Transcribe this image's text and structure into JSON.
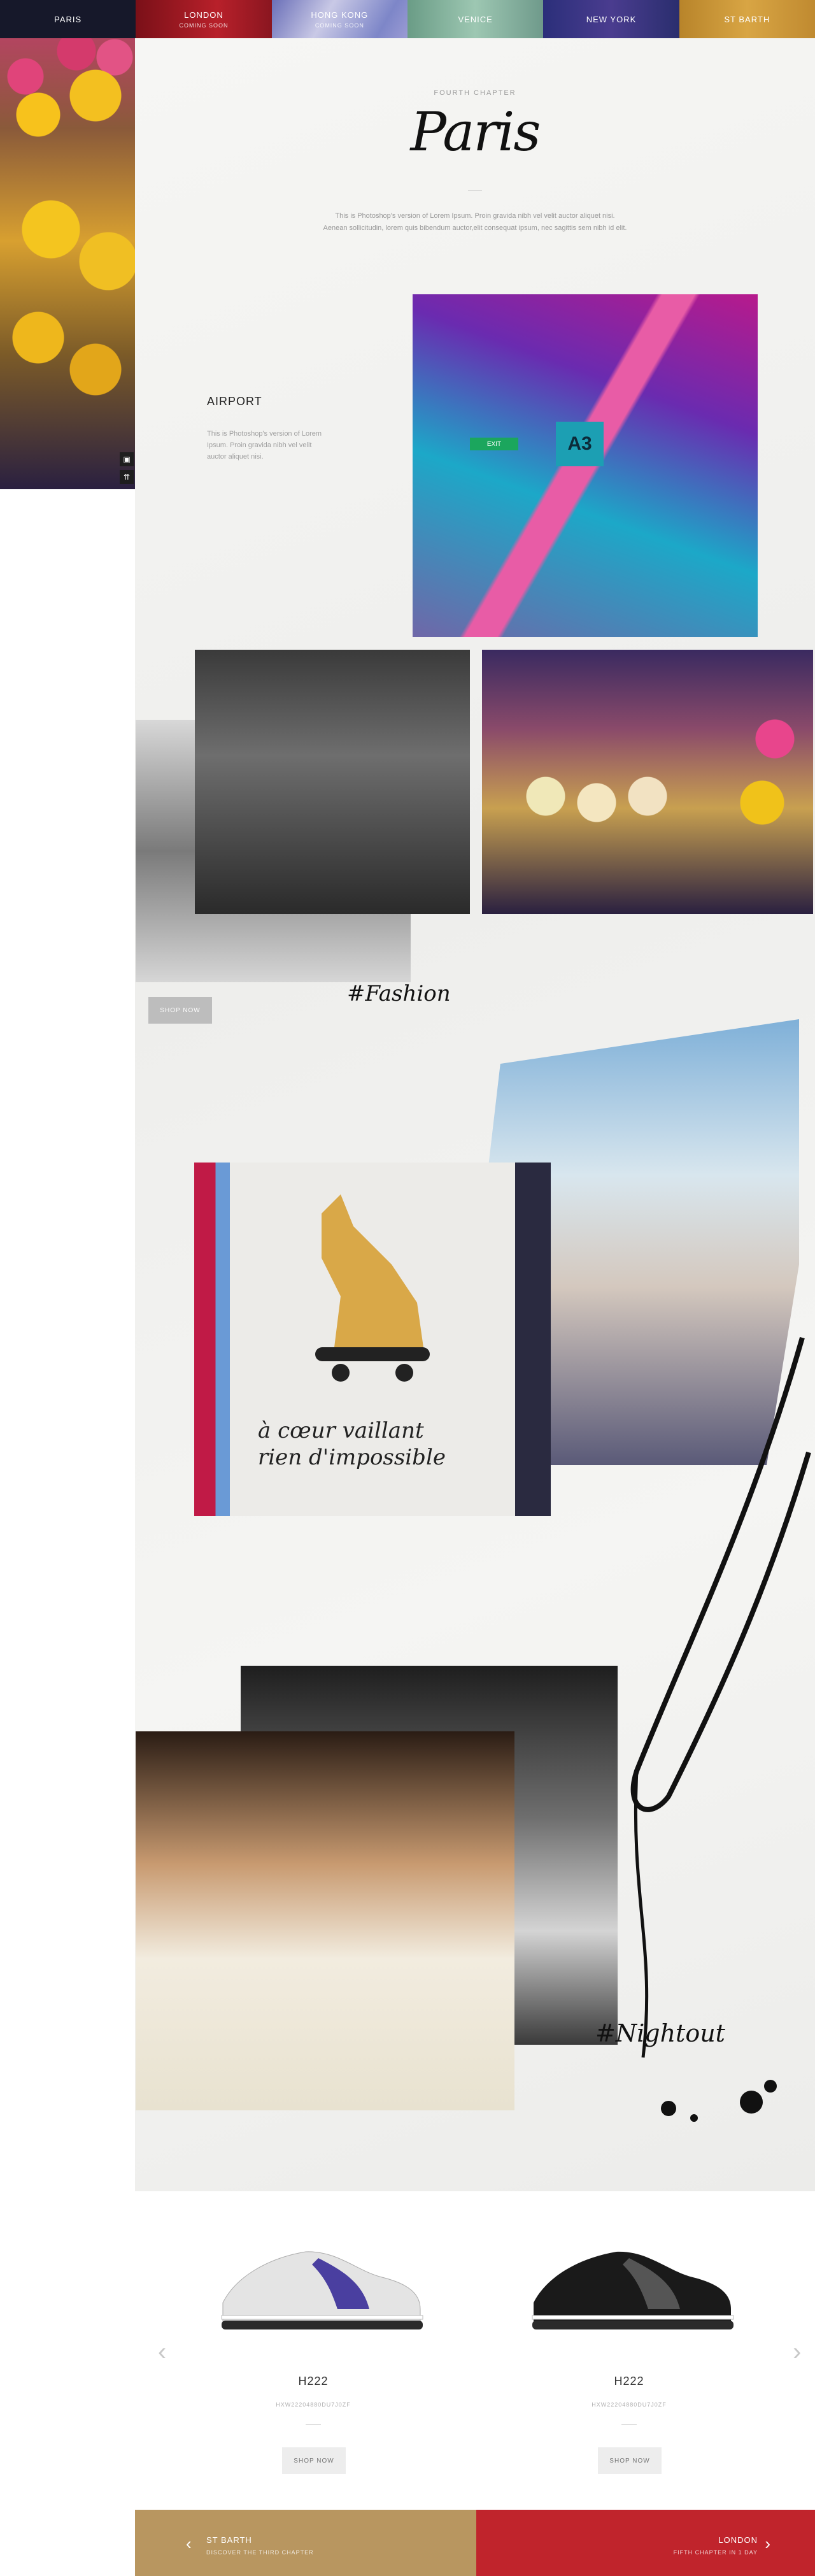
{
  "nav": [
    {
      "label": "PARIS",
      "sub": ""
    },
    {
      "label": "LONDON",
      "sub": "COMING SOON"
    },
    {
      "label": "HONG KONG",
      "sub": "COMING SOON"
    },
    {
      "label": "VENICE",
      "sub": ""
    },
    {
      "label": "NEW YORK",
      "sub": ""
    },
    {
      "label": "ST BARTH",
      "sub": ""
    }
  ],
  "chapter": {
    "label": "FOURTH CHAPTER",
    "title": "Paris",
    "intro_line1": "This is Photoshop's version  of Lorem Ipsum. Proin gravida nibh vel velit auctor aliquet nisi.",
    "intro_line2": "Aenean sollicitudin, lorem quis bibendum auctor,elit consequat ipsum, nec sagittis sem nibh id elit."
  },
  "airport": {
    "title": "AIRPORT",
    "text": "This is Photoshop's version  of Lorem Ipsum. Proin gravida nibh vel velit auctor aliquet nisi."
  },
  "airport_sign": {
    "gate": "A3",
    "exit": "EXIT"
  },
  "fashion": {
    "shop_label": "SHOP NOW",
    "hashtag": "#Fashion"
  },
  "tshirt": {
    "line1": "à cœur vaillant",
    "line2": "rien d'impossible"
  },
  "night": {
    "hashtag": "#Nightout"
  },
  "products": [
    {
      "name": "H222",
      "code": "HXW22204880DU7J0ZF",
      "shop_label": "SHOP NOW"
    },
    {
      "name": "H222",
      "code": "HXW22204880DU7J0ZF",
      "shop_label": "SHOP NOW"
    }
  ],
  "footer": {
    "prev_title": "ST BARTH",
    "prev_sub": "DISCOVER THE THIRD CHAPTER",
    "next_title": "LONDON",
    "next_sub": "FIFTH CHAPTER IN 1 DAY"
  },
  "icons": {
    "instagram": "instagram-icon",
    "share": "share-icon",
    "prev": "chevron-left-icon",
    "next": "chevron-right-icon"
  },
  "colors": {
    "paris": "#16182a",
    "london": "#b8202a",
    "venice": "#9dc7b2",
    "newyork": "#3a3585",
    "stbarth": "#d8a544",
    "footer_left": "#b89660",
    "footer_right": "#c0242c"
  }
}
